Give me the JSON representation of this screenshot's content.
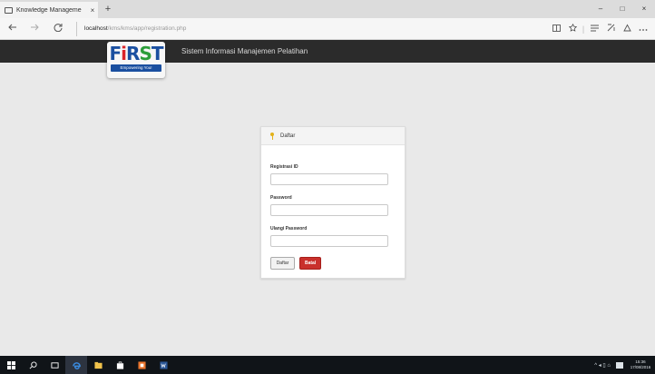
{
  "browser": {
    "tab_title": "Knowledge Manageme",
    "tab_close": "×",
    "new_tab": "+",
    "address_host": "localhost",
    "address_path": "/kms/kms/app/registration.php",
    "icons": {
      "back": "back-arrow-icon",
      "forward": "forward-arrow-icon",
      "refresh": "refresh-icon",
      "reading": "reading-view-icon",
      "favorite": "star-icon",
      "hub": "hub-icon",
      "notes": "web-note-icon",
      "share": "share-icon",
      "more": "more-icon"
    },
    "window_controls": {
      "minimize": "–",
      "maximize": "□",
      "close": "×"
    }
  },
  "header": {
    "app_title": "Sistem Informasi Manajemen Pelatihan",
    "logo": {
      "word": "FiRST",
      "tagline": "Empowering You!",
      "colors": {
        "blue": "#1a4fa0",
        "red": "#d9232a",
        "green": "#2c9d3a"
      }
    }
  },
  "registration": {
    "heading": "Daftar",
    "fields": [
      {
        "label": "Registrasi ID",
        "value": "",
        "placeholder": ""
      },
      {
        "label": "Password",
        "value": "",
        "placeholder": ""
      },
      {
        "label": "Ulangi Password",
        "value": "",
        "placeholder": ""
      }
    ],
    "buttons": {
      "submit": "Daftar",
      "cancel": "Batal"
    }
  },
  "taskbar": {
    "items": [
      "start-icon",
      "search-icon",
      "task-view-icon",
      "edge-icon",
      "file-explorer-icon",
      "store-icon",
      "app-icon",
      "word-icon"
    ],
    "tray": "^ ◂ ▯ ⌂",
    "time": "15:36",
    "date": "17/08/2016"
  },
  "colors": {
    "header_bg": "#2b2b2b",
    "page_bg": "#e9e9e9",
    "cancel_button": "#c9302c",
    "taskbar_bg": "#101418"
  }
}
